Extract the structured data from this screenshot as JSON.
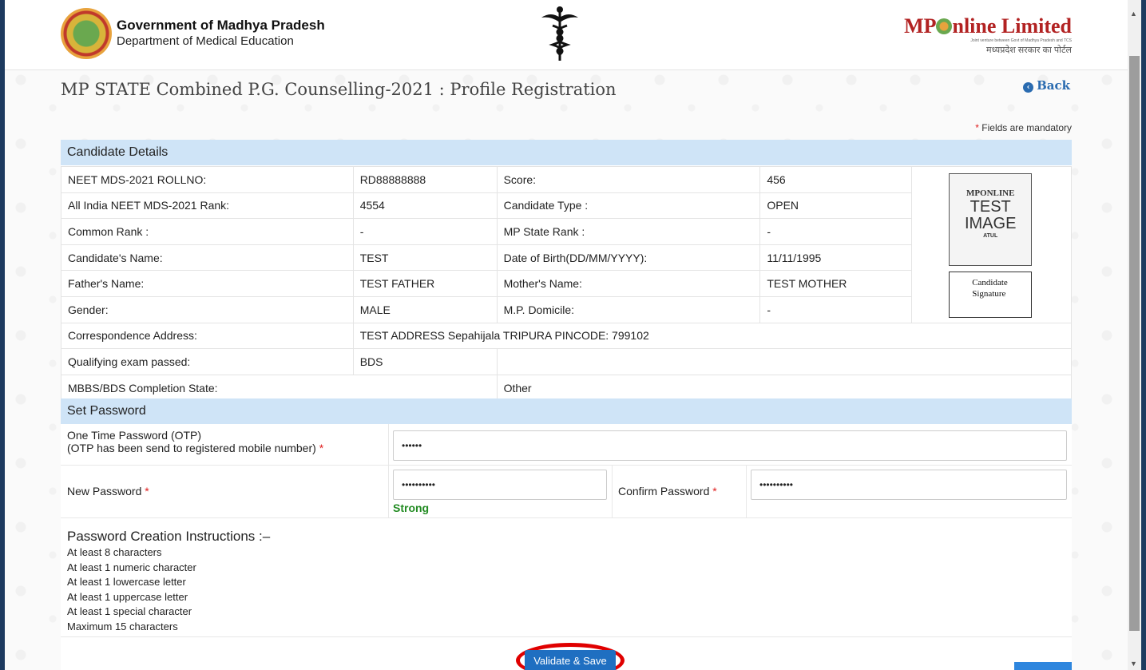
{
  "header": {
    "gov_title": "Government of Madhya Pradesh",
    "gov_subtitle": "Department of Medical Education",
    "mp_logo_prefix": "MP",
    "mp_logo_suffix": "nline Limited",
    "mp_logo_tagline": "Joint venture between Govt of Madhya Pradesh and TCS",
    "mp_logo_hindi": "मध्यप्रदेश सरकार का पोर्टल"
  },
  "page": {
    "title": "MP STATE Combined P.G. Counselling-2021 : Profile Registration",
    "back_label": "Back",
    "mandatory_note": "Fields are mandatory",
    "required_mark": "*"
  },
  "candidate": {
    "section_title": "Candidate Details",
    "rows": [
      {
        "l1": "NEET MDS-2021 ROLLNO:",
        "v1": "RD88888888",
        "l2": "Score:",
        "v2": "456"
      },
      {
        "l1": "All India NEET MDS-2021 Rank:",
        "v1": "4554",
        "l2": "Candidate Type :",
        "v2": "OPEN"
      },
      {
        "l1": "Common Rank :",
        "v1": "-",
        "l2": "MP State Rank :",
        "v2": "-"
      },
      {
        "l1": "Candidate's Name:",
        "v1": "TEST",
        "l2": "Date of Birth(DD/MM/YYYY):",
        "v2": "11/11/1995"
      },
      {
        "l1": "Father's Name:",
        "v1": "TEST FATHER",
        "l2": "Mother's Name:",
        "v2": "TEST MOTHER"
      },
      {
        "l1": "Gender:",
        "v1": "MALE",
        "l2": "M.P. Domicile:",
        "v2": "-"
      }
    ],
    "address_label": "Correspondence Address:",
    "address_value": "TEST ADDRESS Sepahijala TRIPURA PINCODE: 799102",
    "qualifying_label": "Qualifying exam passed:",
    "qualifying_value": "BDS",
    "completion_label": "MBBS/BDS Completion State:",
    "completion_value": "Other",
    "photo": {
      "line1": "MPONLINE",
      "line2": "TEST",
      "line3": "IMAGE",
      "line4": "ATUL"
    },
    "signature": {
      "line1": "Candidate",
      "line2": "Signature"
    }
  },
  "password": {
    "section_title": "Set Password",
    "otp_label": "One Time Password (OTP)",
    "otp_note": "(OTP has been send to registered mobile number)",
    "otp_value": "••••••",
    "new_label": "New Password",
    "new_value": "••••••••••",
    "strength": "Strong",
    "confirm_label": "Confirm Password",
    "confirm_value": "••••••••••",
    "instructions_title": "Password Creation Instructions :–",
    "instructions": [
      "At least 8 characters",
      "At least 1 numeric character",
      "At least 1 lowercase letter",
      "At least 1 uppercase letter",
      "At least 1 special character",
      "Maximum 15 characters"
    ],
    "save_label": "Validate & Save"
  },
  "colors": {
    "section_header": "#cfe4f7",
    "brand_red": "#b22222",
    "primary_button": "#1f6fc1",
    "highlight_ring": "#e00000",
    "strength_green": "#228b22"
  }
}
